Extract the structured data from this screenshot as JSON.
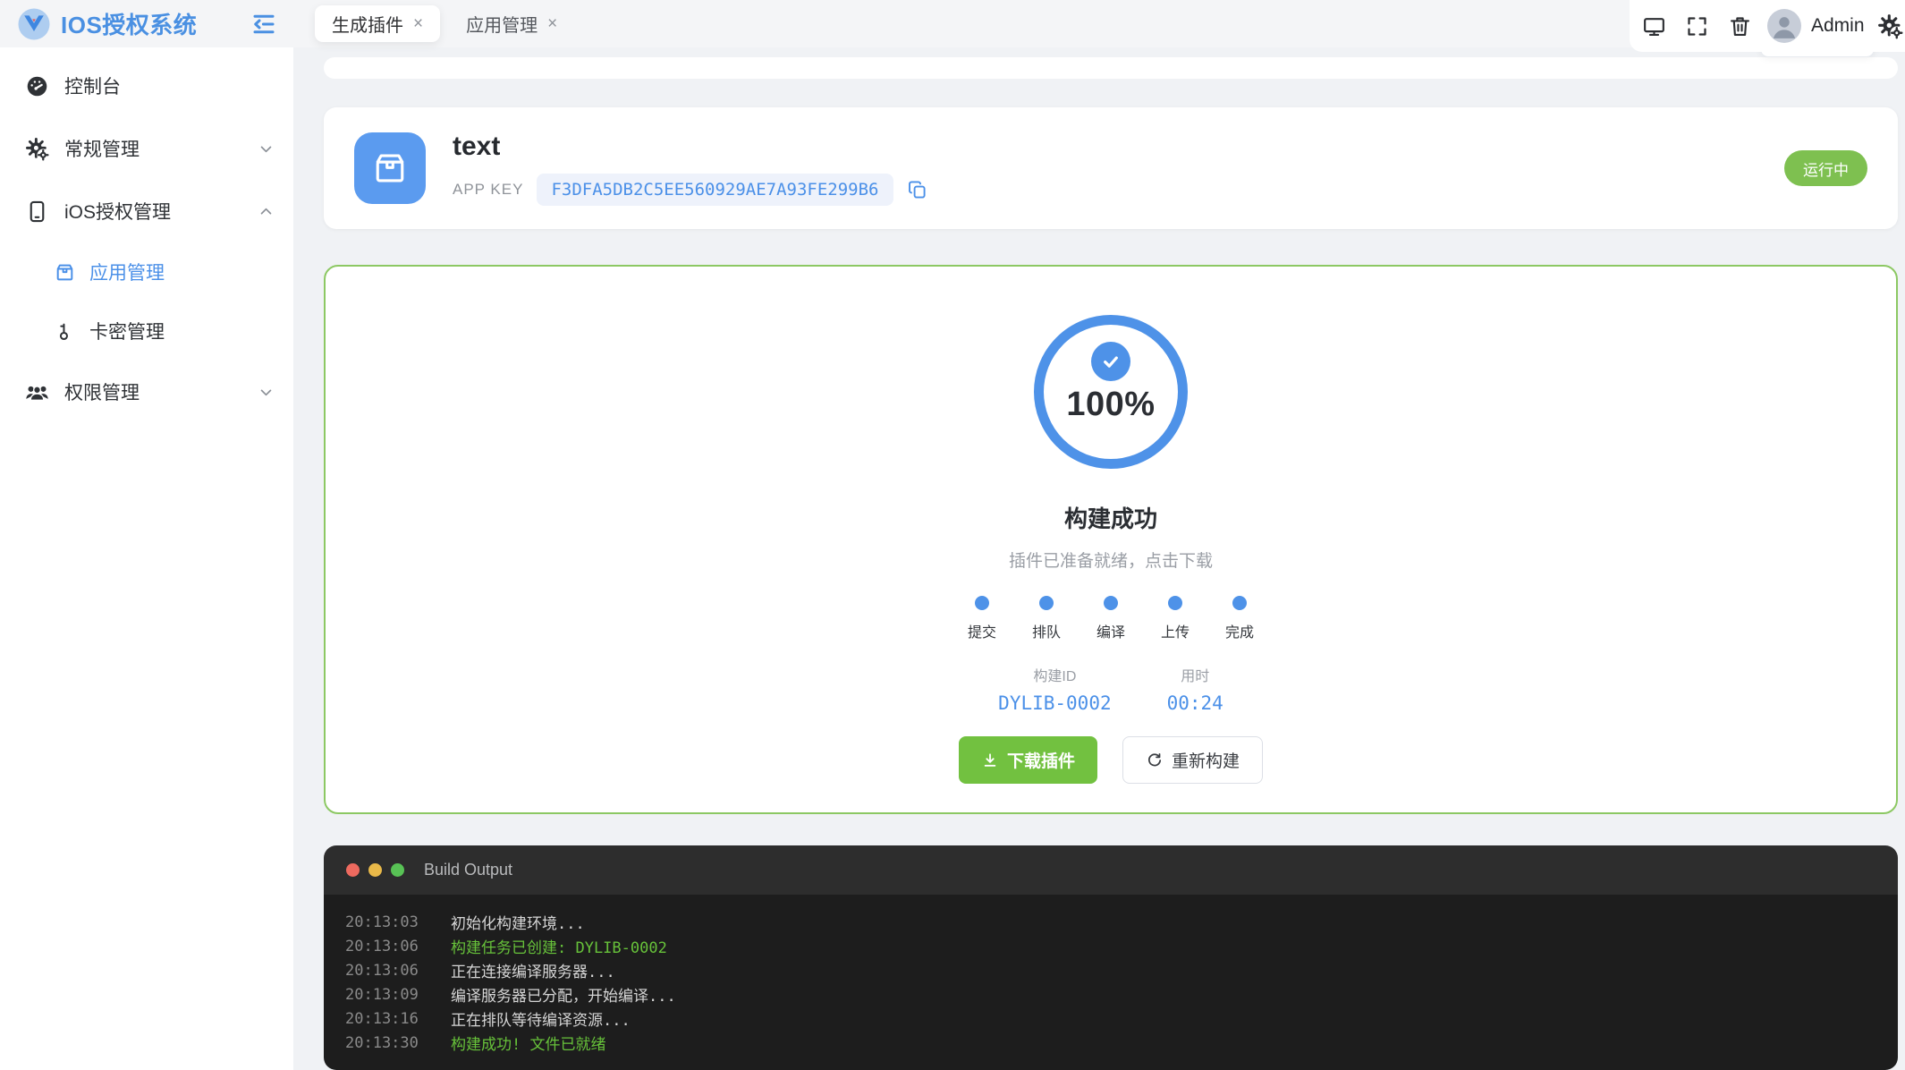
{
  "app": {
    "title": "IOS授权系统",
    "accent_color": "#4b90e8",
    "success_color": "#72c140"
  },
  "sidebar": {
    "items": [
      {
        "label": "控制台"
      },
      {
        "label": "常规管理"
      },
      {
        "label": "iOS授权管理"
      },
      {
        "label": "应用管理"
      },
      {
        "label": "卡密管理"
      },
      {
        "label": "权限管理"
      }
    ]
  },
  "tabs": [
    {
      "label": "生成插件"
    },
    {
      "label": "应用管理"
    }
  ],
  "icons": {
    "close": "×"
  },
  "header": {
    "user": "Admin"
  },
  "app_card": {
    "name": "text",
    "app_key_label": "APP KEY",
    "app_key": "F3DFA5DB2C5EE560929AE7A93FE299B6",
    "status": "运行中"
  },
  "build": {
    "progress": "100%",
    "title": "构建成功",
    "subtitle": "插件已准备就绪，点击下载",
    "steps": [
      "提交",
      "排队",
      "编译",
      "上传",
      "完成"
    ],
    "build_id_label": "构建ID",
    "build_id": "DYLIB-0002",
    "duration_label": "用时",
    "duration": "00:24",
    "download_label": "下载插件",
    "rebuild_label": "重新构建"
  },
  "terminal": {
    "title": "Build Output",
    "lines": [
      {
        "time": "20:13:03",
        "text": "初始化构建环境...",
        "type": "normal"
      },
      {
        "time": "20:13:06",
        "text": "构建任务已创建: DYLIB-0002",
        "type": "success"
      },
      {
        "time": "20:13:06",
        "text": "正在连接编译服务器...",
        "type": "normal"
      },
      {
        "time": "20:13:09",
        "text": "编译服务器已分配，开始编译...",
        "type": "normal"
      },
      {
        "time": "20:13:16",
        "text": "正在排队等待编译资源...",
        "type": "normal"
      },
      {
        "time": "20:13:30",
        "text": "构建成功! 文件已就绪",
        "type": "success"
      }
    ]
  }
}
